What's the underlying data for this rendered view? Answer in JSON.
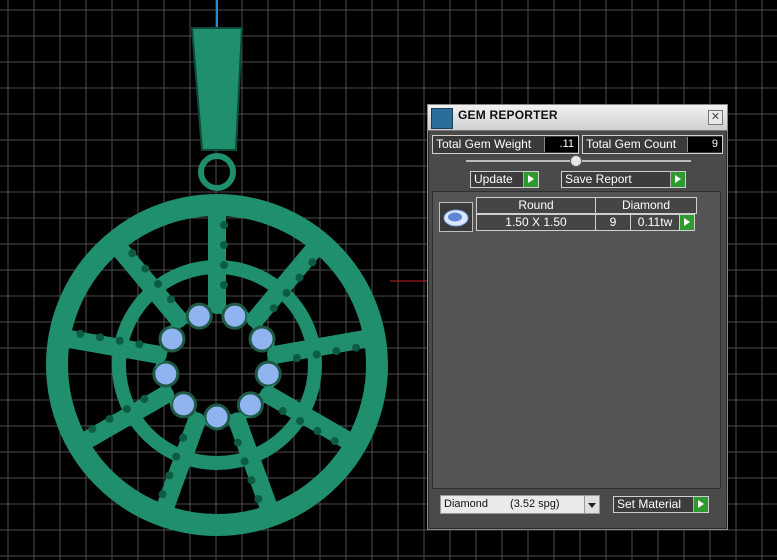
{
  "panel": {
    "title": "GEM REPORTER",
    "close_glyph": "✕",
    "total_weight_label": "Total Gem Weight",
    "total_weight_value": ".11",
    "total_count_label": "Total Gem Count",
    "total_count_value": "9",
    "update_label": "Update",
    "save_report_label": "Save Report",
    "table": {
      "header_shape": "Round",
      "header_material": "Diamond",
      "size": "1.50 X 1.50",
      "count": "9",
      "weight": "0.11tw"
    },
    "material_select": {
      "selected": "Diamond",
      "spg": "(3.52 spg)"
    },
    "set_material_label": "Set Material"
  },
  "colors": {
    "metal_green": "#1f8f6e",
    "gem_blue": "#8fb4f0",
    "grid": "#5a5a5a",
    "accent_green": "#2f9a2f"
  },
  "icons": [
    "gem-reporter-app-icon",
    "close-icon",
    "play-icon",
    "gem-thumbnail-icon",
    "dropdown-arrow-icon"
  ]
}
